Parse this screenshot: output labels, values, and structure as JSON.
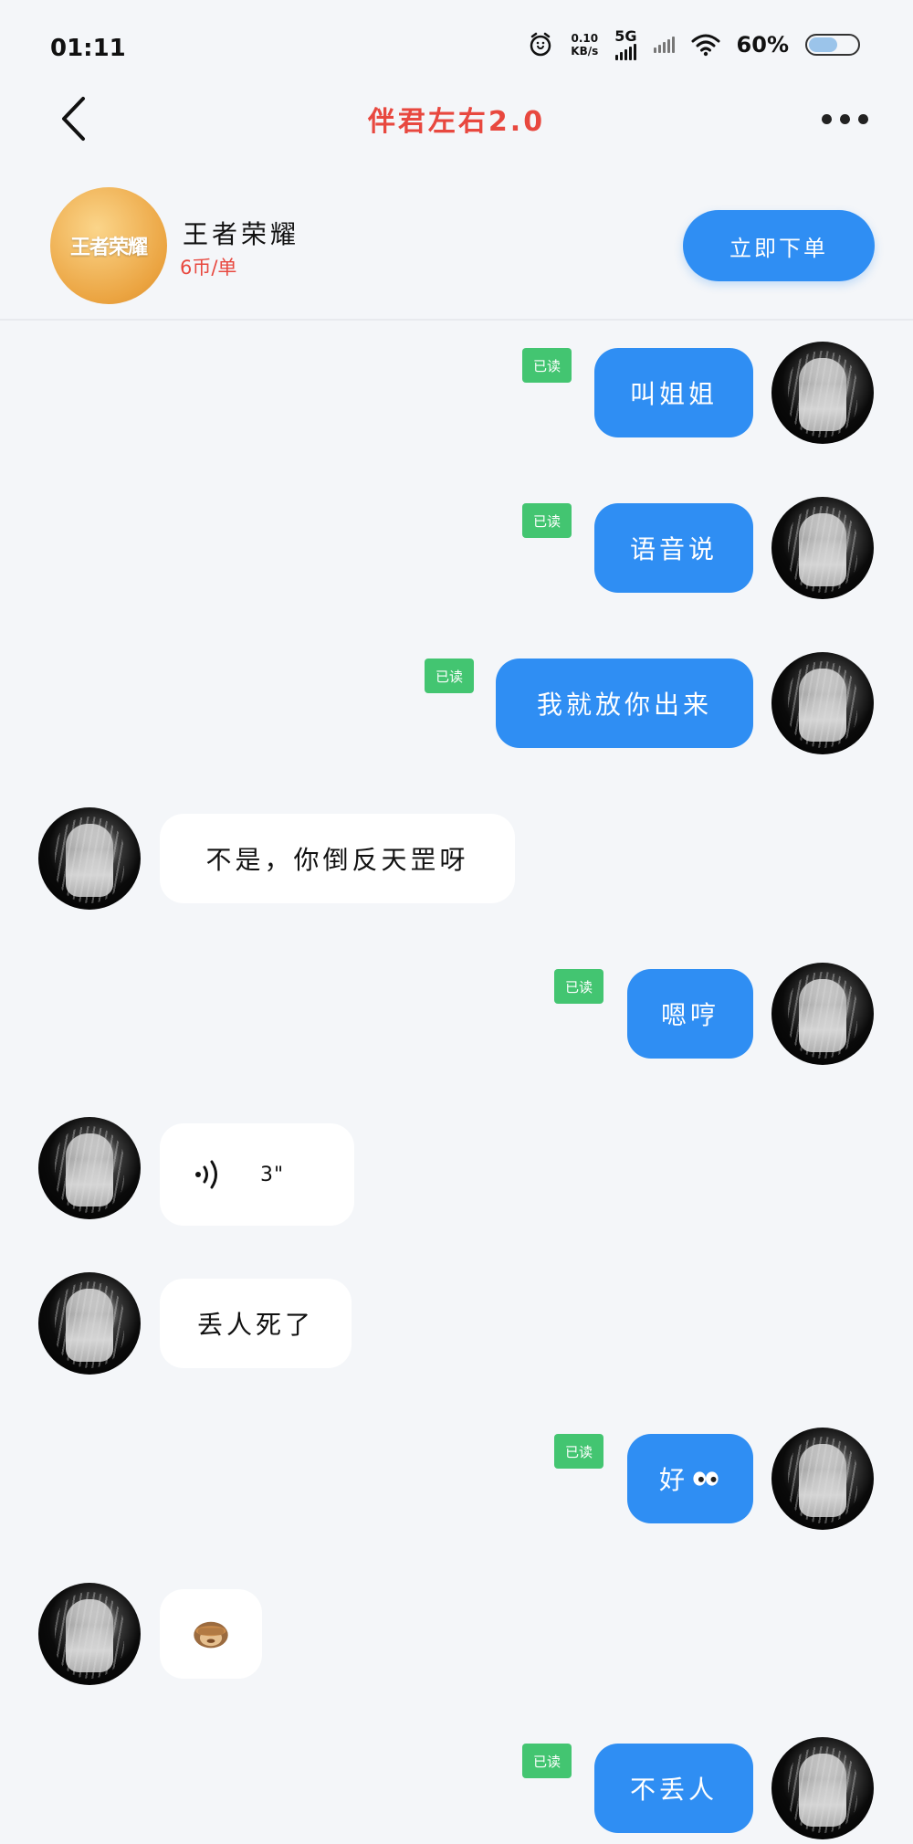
{
  "status_bar": {
    "time": "01:11",
    "net_speed_value": "0.10",
    "net_speed_unit": "KB/s",
    "network": "5G",
    "battery_percent": "60%",
    "battery_level": 0.6,
    "icons": [
      "alarm-icon",
      "signal-bars-icon",
      "signal-bars-icon",
      "wifi-icon",
      "battery-icon"
    ]
  },
  "nav": {
    "title": "伴君左右2.0",
    "back_icon": "chevron-left-icon",
    "more_icon": "more-dots-icon",
    "title_color": "#e8483f"
  },
  "product": {
    "logo_text": "王者荣耀",
    "name": "王者荣耀",
    "price": "6币/单",
    "order_button": "立即下单"
  },
  "colors": {
    "accent": "#2f8ef3",
    "read_badge": "#43c571",
    "price": "#e8483f",
    "background": "#f4f6f9"
  },
  "messages": [
    {
      "side": "out",
      "text": "叫姐姐",
      "read": "已读"
    },
    {
      "side": "out",
      "text": "语音说",
      "read": "已读"
    },
    {
      "side": "out",
      "text": "我就放你出来",
      "read": "已读"
    },
    {
      "side": "in",
      "text": "不是，你倒反天罡呀"
    },
    {
      "side": "out",
      "text": "嗯哼",
      "read": "已读"
    },
    {
      "side": "in",
      "type": "voice",
      "duration": "3\"",
      "icon": "voice-wave-icon"
    },
    {
      "side": "in",
      "text": "丢人死了"
    },
    {
      "side": "out",
      "text": "好",
      "emoji": "eyes-emoji",
      "read": "已读"
    },
    {
      "side": "in",
      "type": "emoji",
      "emoji": "monkey-see-no-evil-emoji"
    },
    {
      "side": "out",
      "text": "不丢人",
      "read": "已读"
    }
  ]
}
